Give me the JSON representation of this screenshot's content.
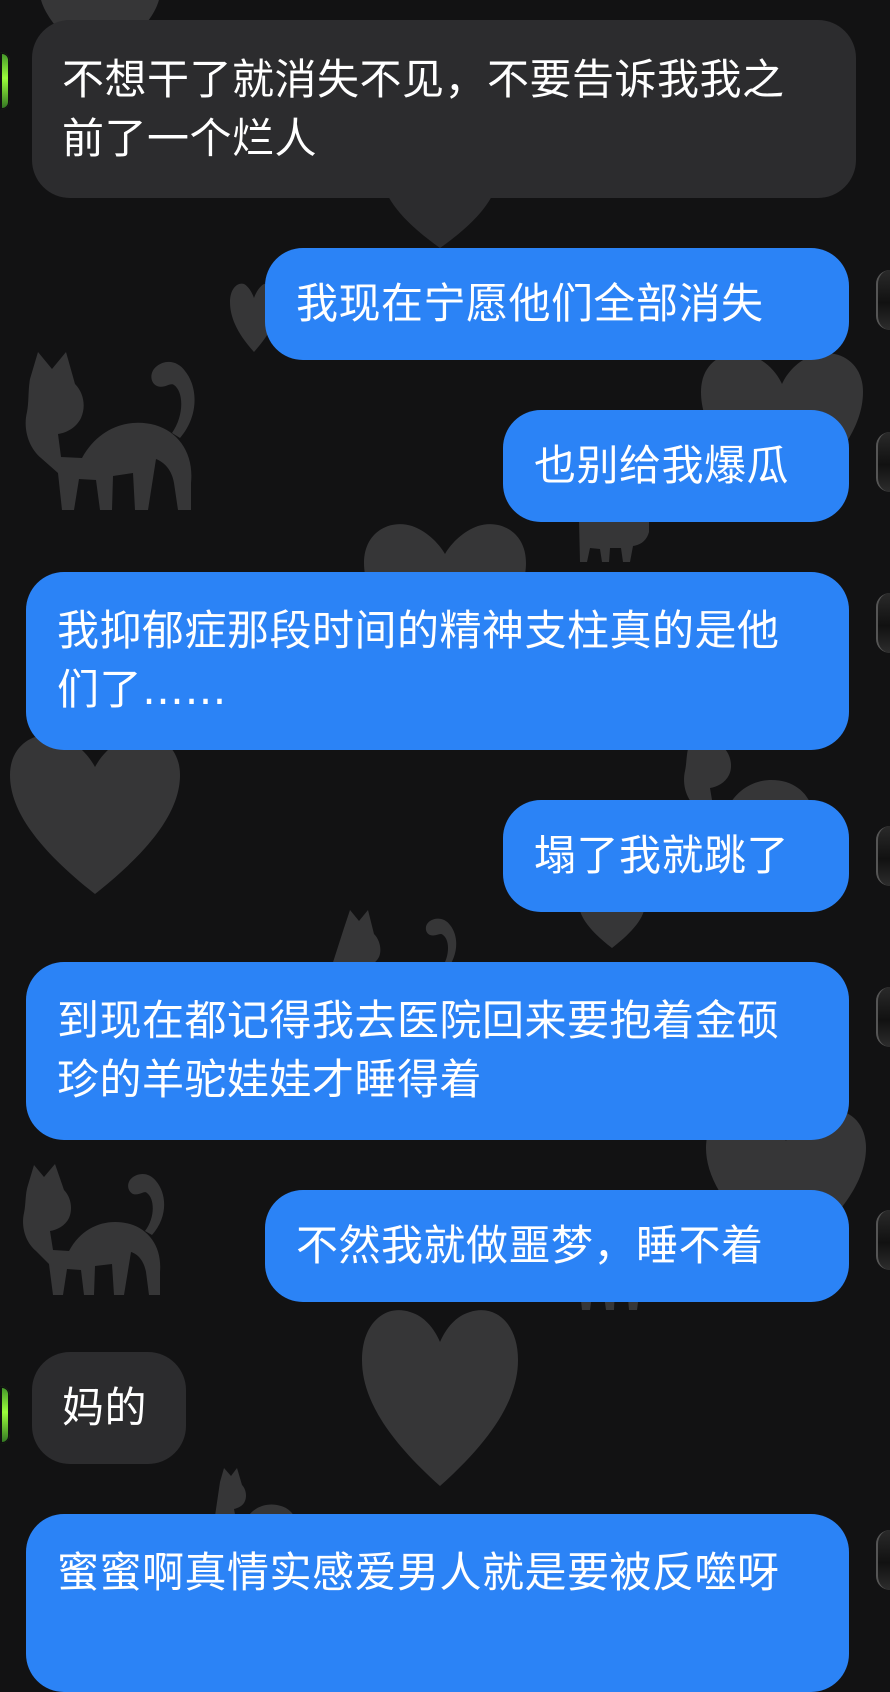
{
  "conversation": {
    "messages": [
      {
        "direction": "incoming",
        "text": "不想干了就消失不见，不要告诉我我之前了一个烂人"
      },
      {
        "direction": "outgoing",
        "text": "我现在宁愿他们全部消失"
      },
      {
        "direction": "outgoing",
        "text": "也别给我爆瓜"
      },
      {
        "direction": "outgoing",
        "text": "我抑郁症那段时间的精神支柱真的是他们了……"
      },
      {
        "direction": "outgoing",
        "text": "塌了我就跳了"
      },
      {
        "direction": "outgoing",
        "text": "到现在都记得我去医院回来要抱着金硕珍的羊驼娃娃才睡得着"
      },
      {
        "direction": "outgoing",
        "text": "不然我就做噩梦，睡不着"
      },
      {
        "direction": "incoming",
        "text": "妈的"
      },
      {
        "direction": "outgoing",
        "text": "蜜蜜啊真情实感爱男人就是要被反噬呀"
      }
    ]
  },
  "theme": {
    "background": "#121213",
    "incoming_bubble": "#2c2c2e",
    "outgoing_bubble": "#2b83f6",
    "text": "#ffffff",
    "wallpaper_shape": "#3a3a3c",
    "avatar_accent": "#7ee232"
  },
  "icons": {
    "wallpaper_heart": "heart-icon",
    "wallpaper_cat": "cat-icon"
  }
}
